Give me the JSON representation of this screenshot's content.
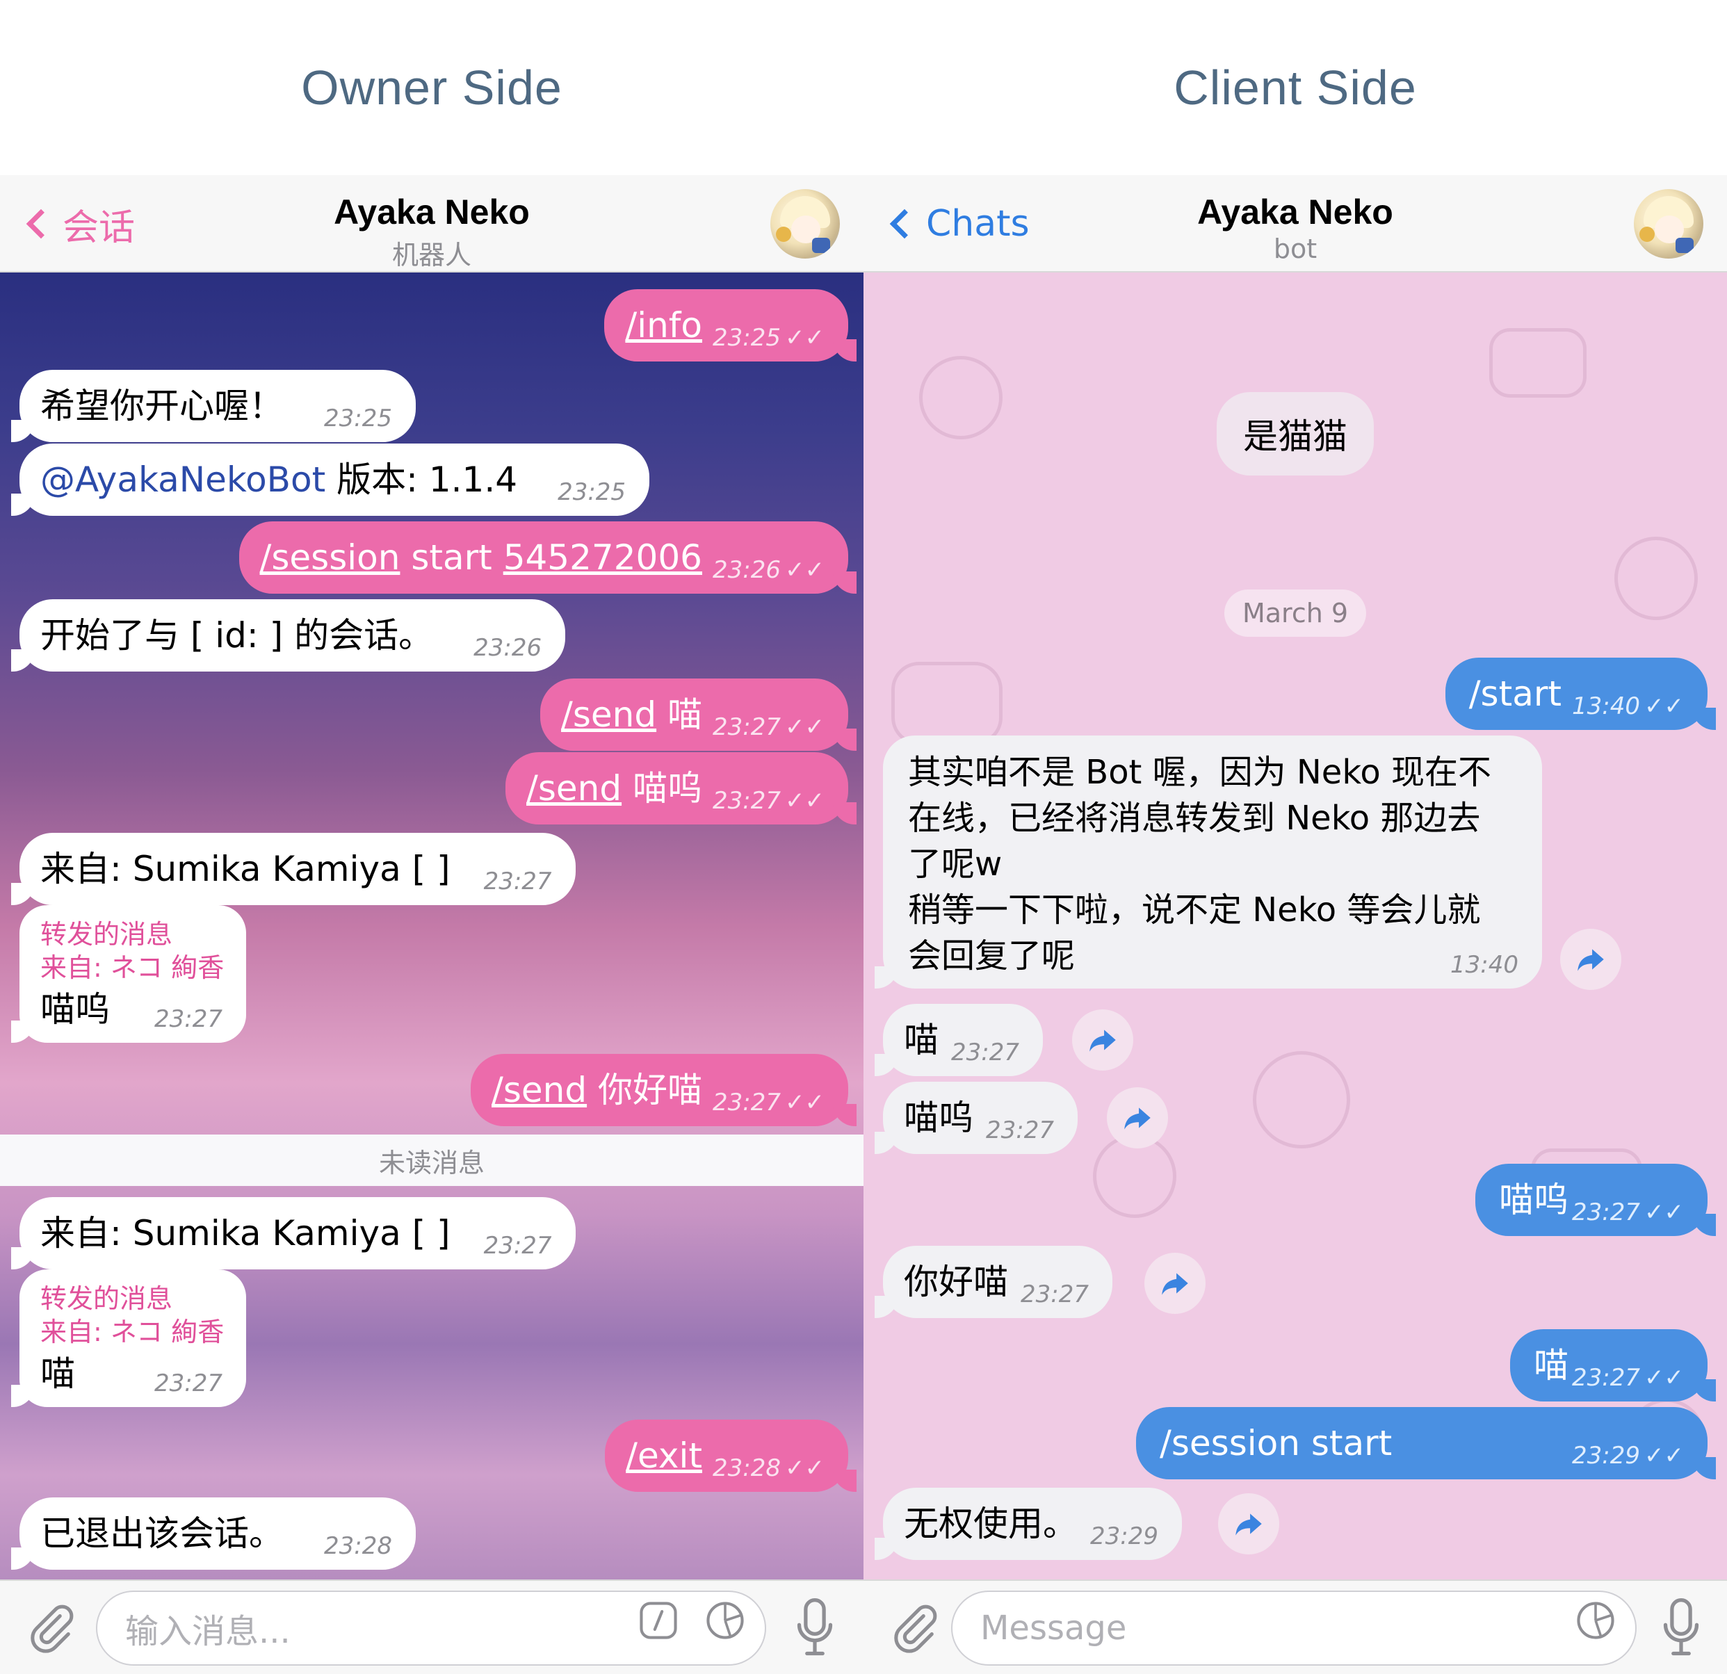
{
  "owner": {
    "side_title": "Owner Side",
    "nav": {
      "back_label": "会话",
      "title": "Ayaka Neko",
      "subtitle": "机器人"
    },
    "messages": [
      {
        "cmd": "/info",
        "time": "23:25"
      },
      {
        "text": "希望你开心喔！",
        "time": "23:25"
      },
      {
        "mention": "@AyakaNekoBot",
        "text": " 版本: 1.1.4",
        "time": "23:25"
      },
      {
        "cmd": "/session",
        "mid": " start ",
        "arg": "545272006",
        "time": "23:26"
      },
      {
        "text": "开始了与 [ id:                    ] 的会话。",
        "time": "23:26"
      },
      {
        "cmd": "/send",
        "text": " 喵",
        "time": "23:27"
      },
      {
        "cmd": "/send",
        "text": " 喵呜",
        "time": "23:27"
      },
      {
        "text": "来自: Sumika Kamiya [                      ]",
        "time": "23:27"
      },
      {
        "fwd_label": "转发的消息",
        "fwd_from": "来自: ネコ 絢香",
        "text": "喵呜",
        "time": "23:27"
      },
      {
        "cmd": "/send",
        "text": " 你好喵",
        "time": "23:27"
      },
      {
        "text": "来自: Sumika Kamiya [                      ]",
        "time": "23:27"
      },
      {
        "fwd_label": "转发的消息",
        "fwd_from": "来自: ネコ 絢香",
        "text": "喵",
        "time": "23:27"
      },
      {
        "cmd": "/exit",
        "time": "23:28"
      },
      {
        "text": "已退出该会话。",
        "time": "23:28"
      }
    ],
    "unread_label": "未读消息",
    "input_placeholder": "输入消息..."
  },
  "client": {
    "side_title": "Client Side",
    "nav": {
      "back_label": "Chats",
      "title": "Ayaka Neko",
      "subtitle": "bot"
    },
    "top_pill": "是猫猫",
    "date_label": "March 9",
    "messages": [
      {
        "text": "/start",
        "time": "13:40"
      },
      {
        "lines": [
          "其实咱不是 Bot 喔，因为 Neko 现在不",
          "在线，已经将消息转发到 Neko 那边去",
          "了呢w",
          "稍等一下下啦，说不定 Neko 等会儿就",
          "会回复了呢"
        ],
        "time": "13:40"
      },
      {
        "text": "喵",
        "time": "23:27"
      },
      {
        "text": "喵呜",
        "time": "23:27"
      },
      {
        "text": "喵呜",
        "time": "23:27"
      },
      {
        "text": "你好喵",
        "time": "23:27"
      },
      {
        "text": "喵",
        "time": "23:27"
      },
      {
        "text": "/session start",
        "time": "23:29"
      },
      {
        "text": "无权使用。",
        "time": "23:29"
      }
    ],
    "input_placeholder": "Message"
  },
  "colors": {
    "owner_accent": "#ec6bab",
    "client_accent": "#4a90e2",
    "title_color": "#4e6982"
  },
  "icons": [
    "chevron-left-icon",
    "attach-icon",
    "command-icon",
    "sticker-icon",
    "mic-icon",
    "share-icon",
    "read-check-icon"
  ]
}
